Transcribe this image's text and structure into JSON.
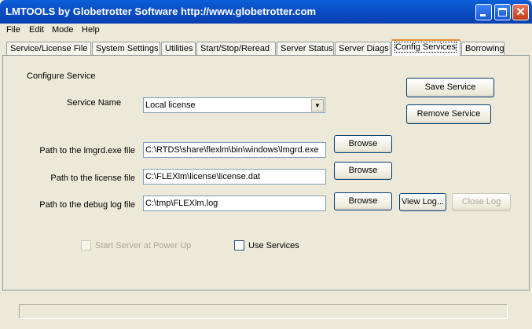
{
  "window": {
    "title": "LMTOOLS by Globetrotter Software http://www.globetrotter.com"
  },
  "menu": [
    "File",
    "Edit",
    "Mode",
    "Help"
  ],
  "tabs": [
    {
      "label": "Service/License File"
    },
    {
      "label": "System Settings"
    },
    {
      "label": "Utilities"
    },
    {
      "label": "Start/Stop/Reread"
    },
    {
      "label": "Server Status"
    },
    {
      "label": "Server Diags"
    },
    {
      "label": "Config Services",
      "selected": true
    },
    {
      "label": "Borrowing"
    }
  ],
  "config": {
    "heading": "Configure Service",
    "service_name_label": "Service Name",
    "service_name_value": "Local license",
    "save_service": "Save Service",
    "remove_service": "Remove Service",
    "lmgrd_label": "Path to the lmgrd.exe file",
    "lmgrd_value": "C:\\RTDS\\share\\flexlm\\bin\\windows\\lmgrd.exe",
    "license_label": "Path to the license file",
    "license_value": "C:\\FLEXlm\\license\\license.dat",
    "log_label": "Path to the debug log file",
    "log_value": "C:\\tmp\\FLEXlm.log",
    "browse": "Browse",
    "view_log": "View Log...",
    "close_log": "Close Log",
    "start_at_power_up": "Start Server at Power Up",
    "use_services": "Use Services"
  }
}
